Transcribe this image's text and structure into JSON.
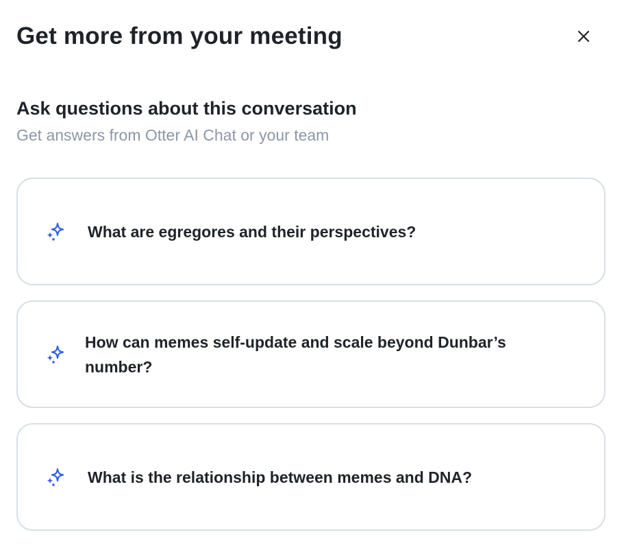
{
  "header": {
    "title": "Get more from your meeting",
    "close_icon": "close-icon"
  },
  "section": {
    "title": "Ask questions about this conversation",
    "subtitle": "Get answers from Otter AI Chat or your team"
  },
  "suggestions": [
    {
      "icon": "sparkle-icon",
      "label": "What are egregores and their perspectives?"
    },
    {
      "icon": "sparkle-icon",
      "label": "How can memes self-update and scale beyond Dunbar’s number?"
    },
    {
      "icon": "sparkle-icon",
      "label": "What is the relationship between memes and DNA?"
    }
  ],
  "colors": {
    "accent": "#2f5fe3",
    "text": "#1f2329",
    "muted": "#8c97a6",
    "border": "#d9dee5"
  }
}
